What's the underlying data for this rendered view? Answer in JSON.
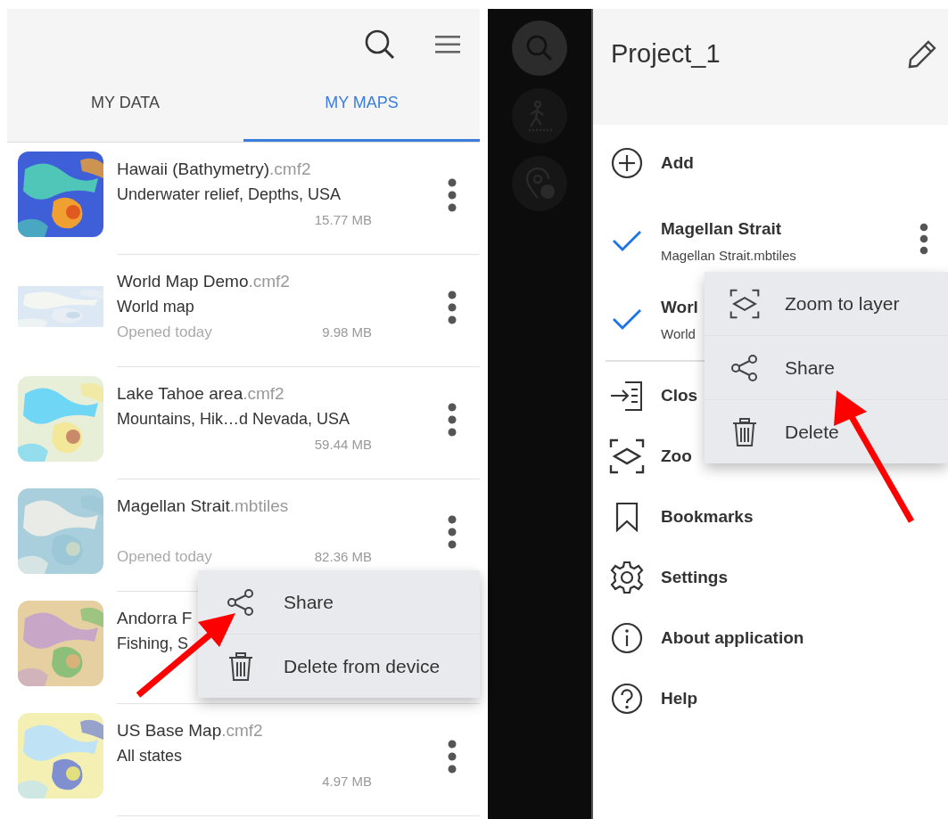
{
  "left_screen": {
    "tabs": [
      {
        "label": "MY DATA",
        "selected": false
      },
      {
        "label": "MY MAPS",
        "selected": true
      }
    ],
    "maps": [
      {
        "kind": "square",
        "title": "Hawaii (Bathymetry)",
        "extension": ".cmf2",
        "description": "Underwater relief, Depths, USA",
        "size": "15.77 MB",
        "more_button": true
      },
      {
        "kind": "wide",
        "title": "World Map Demo",
        "extension": ".cmf2",
        "description": "World map",
        "opened": "Opened today",
        "size": "9.98 MB",
        "more_button": true
      },
      {
        "kind": "square",
        "title": "Lake Tahoe area",
        "extension": ".cmf2",
        "description": "Mountains, Hik…d Nevada, USA",
        "size": "59.44 MB",
        "more_button": true
      },
      {
        "kind": "square",
        "title": "Magellan Strait",
        "extension": ".mbtiles",
        "opened": "Opened today",
        "size": "82.36 MB",
        "more_button": true
      },
      {
        "kind": "square",
        "title": "Andorra F",
        "description": "Fishing, S",
        "more_button": false
      },
      {
        "kind": "square",
        "title": "US Base Map",
        "extension": ".cmf2",
        "description": "All states",
        "size": "4.97 MB",
        "more_button": true
      }
    ],
    "context_menu": [
      {
        "kind": "share",
        "label": "Share"
      },
      {
        "kind": "delete",
        "label": "Delete from device"
      }
    ]
  },
  "right_screen": {
    "drawer": {
      "title": "Project_1",
      "items": [
        {
          "kind": "add",
          "label": "Add"
        },
        {
          "kind": "layer",
          "label": "Magellan Strait",
          "file": "Magellan Strait.mbtiles",
          "checked": true,
          "more_button": true
        },
        {
          "kind": "layer",
          "label": "Worl",
          "file": "World",
          "checked": true,
          "more_button": false
        },
        {
          "kind": "divider"
        },
        {
          "kind": "close",
          "label": "Clos"
        },
        {
          "kind": "zoom",
          "label": "Zoo"
        },
        {
          "kind": "bookmark",
          "label": "Bookmarks"
        },
        {
          "kind": "settings",
          "label": "Settings"
        },
        {
          "kind": "about",
          "label": "About application"
        },
        {
          "kind": "help",
          "label": "Help"
        }
      ]
    },
    "context_menu": [
      {
        "kind": "zoom",
        "label": "Zoom to layer"
      },
      {
        "kind": "share",
        "label": "Share"
      },
      {
        "kind": "delete",
        "label": "Delete"
      }
    ]
  }
}
